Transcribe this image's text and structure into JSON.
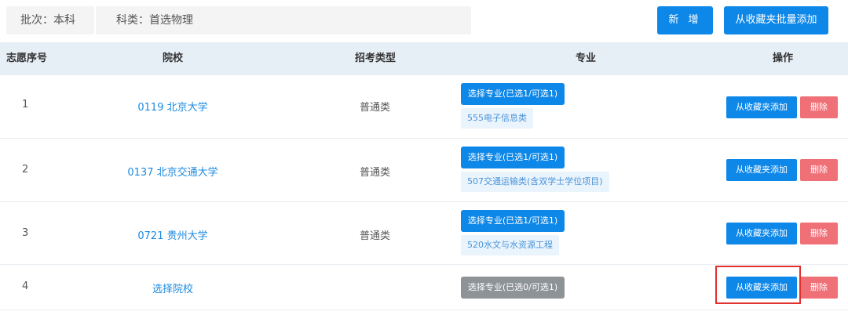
{
  "filter": {
    "batch": "批次：本科",
    "subject": "科类：首选物理"
  },
  "toolbar": {
    "add_label": "新 增",
    "batch_add_label": "从收藏夹批量添加"
  },
  "columns": [
    "志愿序号",
    "院校",
    "招考类型",
    "专业",
    "操作"
  ],
  "rows": [
    {
      "index": "1",
      "school": "0119 北京大学",
      "type": "普通类",
      "select_label": "选择专业(已选1/可选1)",
      "major": "555电子信息类",
      "add_label": "从收藏夹添加",
      "delete_label": "删除"
    },
    {
      "index": "2",
      "school": "0137 北京交通大学",
      "type": "普通类",
      "select_label": "选择专业(已选1/可选1)",
      "major": "507交通运输类(含双学士学位项目)",
      "add_label": "从收藏夹添加",
      "delete_label": "删除"
    },
    {
      "index": "3",
      "school": "0721 贵州大学",
      "type": "普通类",
      "select_label": "选择专业(已选1/可选1)",
      "major": "520水文与水资源工程",
      "add_label": "从收藏夹添加",
      "delete_label": "删除"
    },
    {
      "index": "4",
      "school": "选择院校",
      "type": "",
      "select_label": "选择专业(已选0/可选1)",
      "major": "",
      "add_label": "从收藏夹添加",
      "delete_label": "删除"
    }
  ],
  "colors": {
    "primary": "#0d87e8",
    "danger": "#f07078",
    "disabled": "#8e9398",
    "header_bg": "#e6eef6",
    "highlight": "#e0312e"
  }
}
